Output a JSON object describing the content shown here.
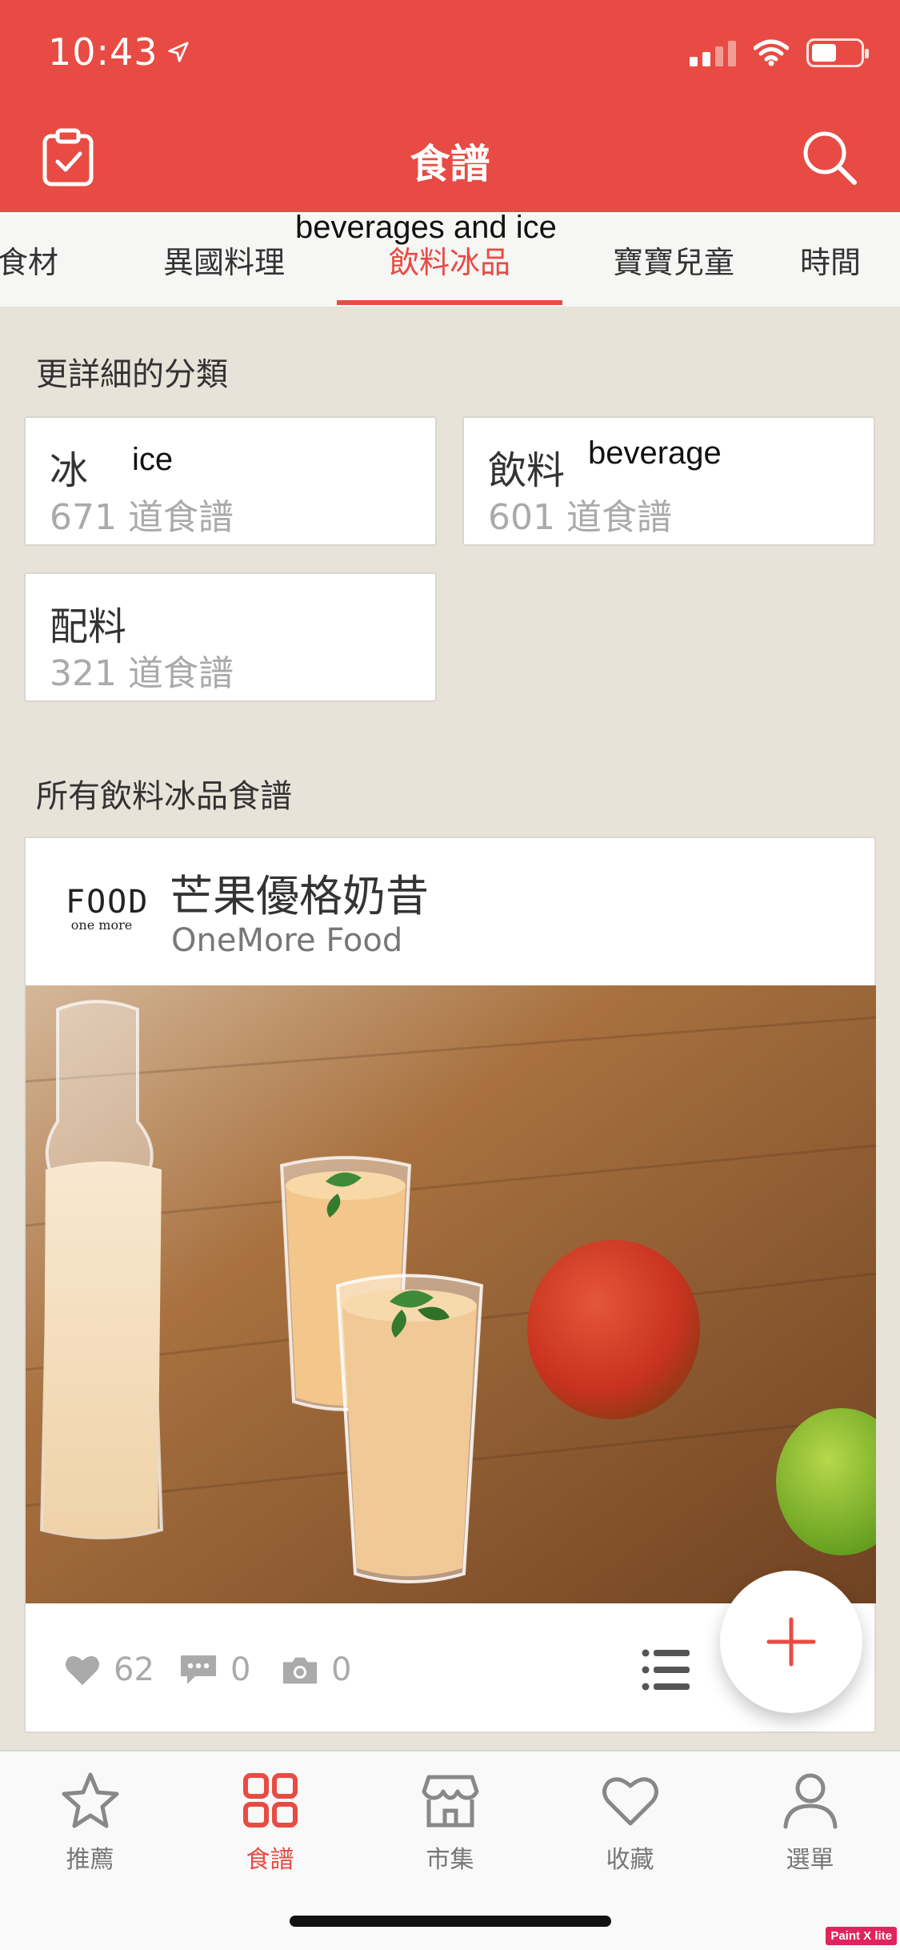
{
  "status_bar": {
    "time": "10:43"
  },
  "header": {
    "title": "食譜"
  },
  "tabs": [
    {
      "label": "食材"
    },
    {
      "label": "異國料理"
    },
    {
      "label": "飲料冰品"
    },
    {
      "label": "寶寶兒童"
    },
    {
      "label": "時間"
    }
  ],
  "tab_annotation": "beverages and ice",
  "subcategories": {
    "title": "更詳細的分類",
    "items": [
      {
        "name": "冰",
        "count": "671 道食譜",
        "annotation": "ice"
      },
      {
        "name": "飲料",
        "count": "601 道食譜",
        "annotation": "beverage"
      },
      {
        "name": "配料",
        "count": "321 道食譜"
      }
    ]
  },
  "all_recipes": {
    "title": "所有飲料冰品食譜",
    "card": {
      "title": "芒果優格奶昔",
      "author": "OneMore Food",
      "logo_main": "FOOD",
      "logo_sub": "one more",
      "likes": "62",
      "comments": "0",
      "photos": "0"
    }
  },
  "bottom_nav": [
    {
      "label": "推薦",
      "icon": "star-icon"
    },
    {
      "label": "食譜",
      "icon": "grid-icon"
    },
    {
      "label": "市集",
      "icon": "store-icon"
    },
    {
      "label": "收藏",
      "icon": "heart-icon"
    },
    {
      "label": "選單",
      "icon": "person-icon"
    }
  ],
  "watermark": "Paint X lite",
  "colors": {
    "accent": "#e84b43",
    "background": "#e8e3d9"
  }
}
